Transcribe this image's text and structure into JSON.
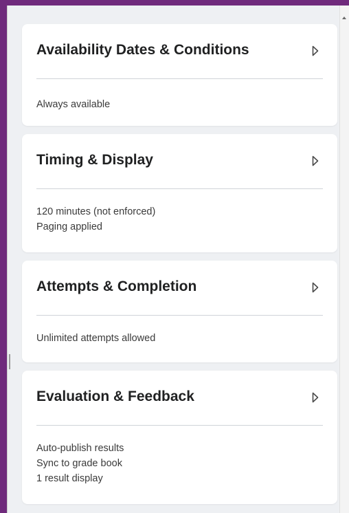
{
  "cards": [
    {
      "title": "Availability Dates & Conditions",
      "lines": [
        "Always available"
      ]
    },
    {
      "title": "Timing & Display",
      "lines": [
        "120 minutes (not enforced)",
        "Paging applied"
      ]
    },
    {
      "title": "Attempts & Completion",
      "lines": [
        "Unlimited attempts allowed"
      ]
    },
    {
      "title": "Evaluation & Feedback",
      "lines": [
        "Auto-publish results",
        "Sync to grade book",
        "1 result display"
      ]
    }
  ],
  "icons": {
    "expand": "chevron-right-icon",
    "scroll_up": "scroll-up-arrow-icon"
  },
  "colors": {
    "frame": "#6f2a7c",
    "pane_background": "#eef0f3",
    "card_background": "#ffffff",
    "title_text": "#202122",
    "summary_text": "#3a3a3a"
  }
}
